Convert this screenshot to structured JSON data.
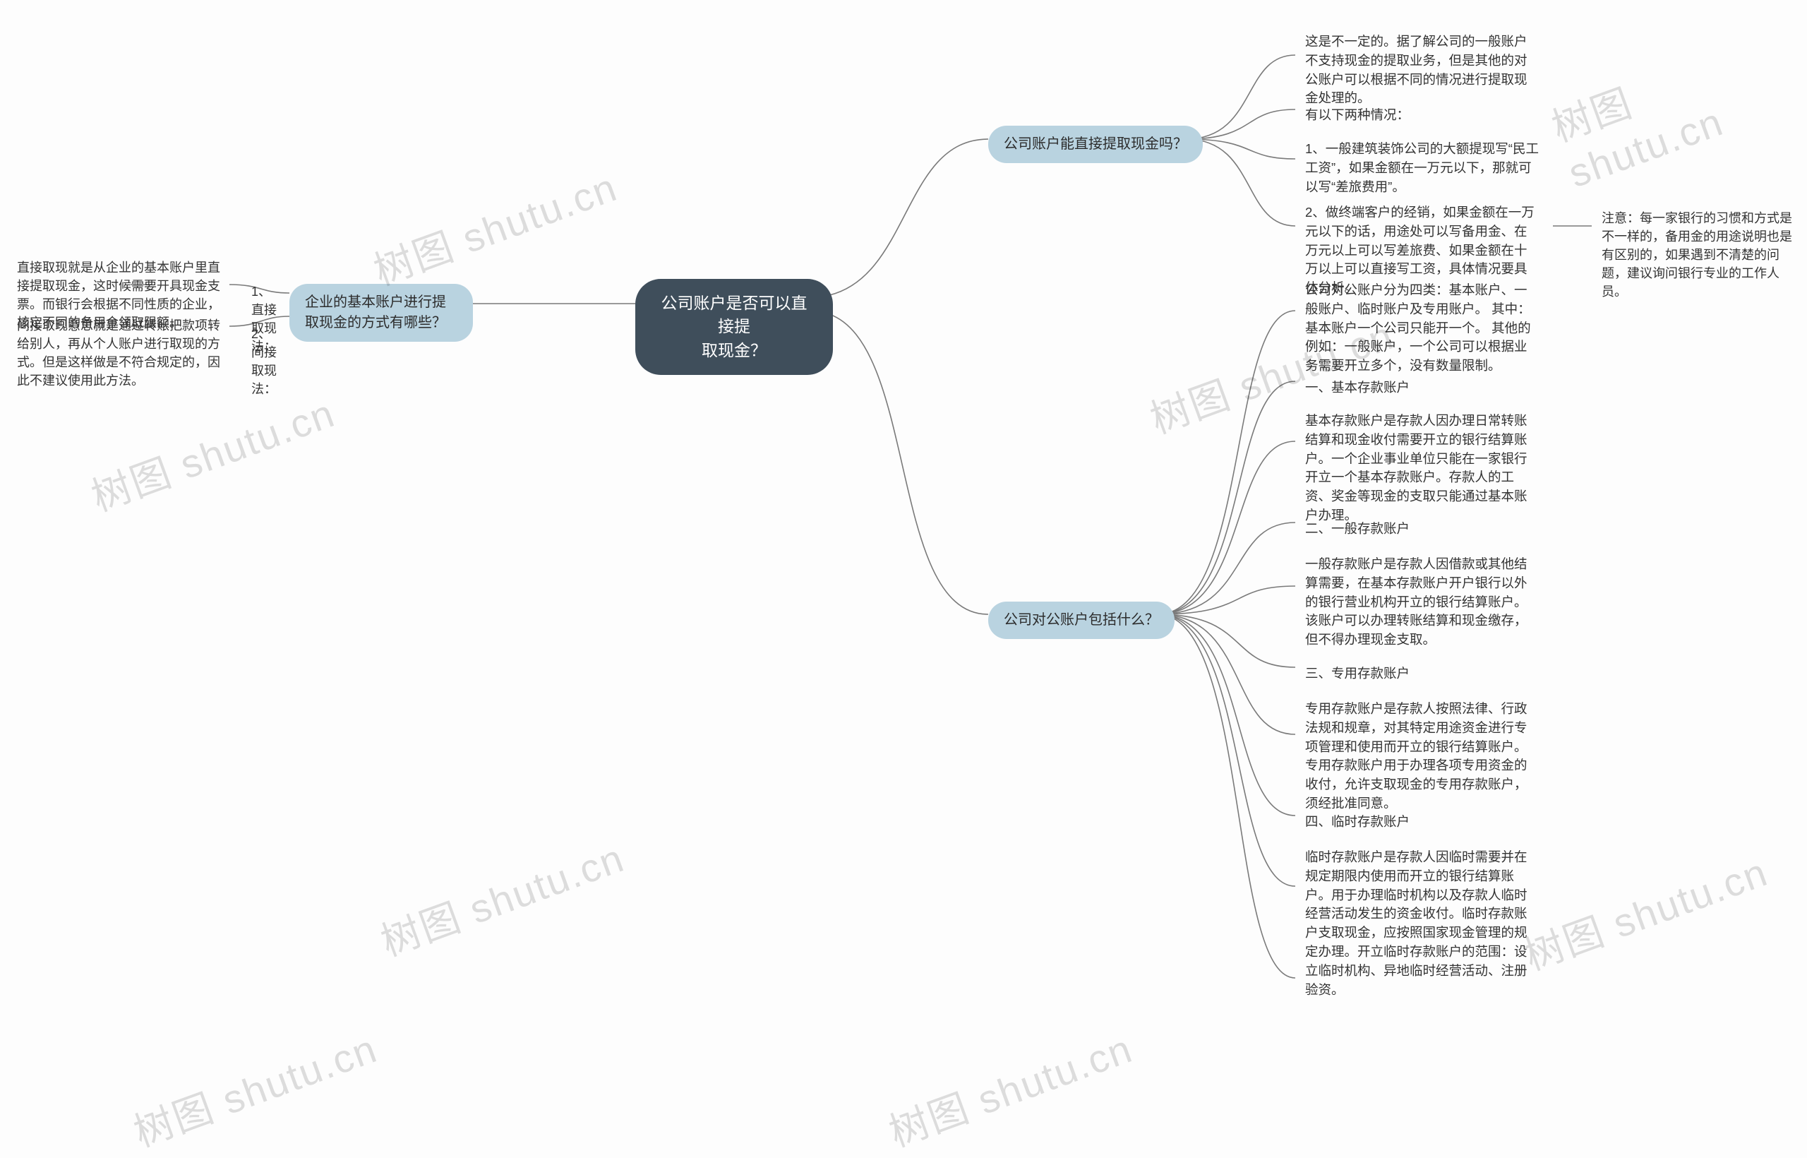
{
  "root": {
    "title_line1": "公司账户是否可以直接提",
    "title_line2": "取现金？"
  },
  "left": {
    "branch": "企业的基本账户进行提取现金的方式有哪些？",
    "item1": {
      "label": "1、直接取现法：",
      "desc": "直接取现就是从企业的基本账户里直接提取现金，这时候需要开具现金支票。而银行会根据不同性质的企业，核定不同的备用金领取限额。"
    },
    "item2": {
      "label": "2、间接取现法：",
      "desc": "间接取现意思就是通过转账把款项转给别人，再从个人账户进行取现的方式。但是这样做是不符合规定的，因此不建议使用此方法。"
    }
  },
  "right_top": {
    "branch": "公司账户能直接提取现金吗？",
    "n1": "这是不一定的。据了解公司的一般账户不支持现金的提取业务，但是其他的对公账户可以根据不同的情况进行提取现金处理的。",
    "n2": "有以下两种情况：",
    "n3": "1、一般建筑装饰公司的大额提现写“民工工资”，如果金额在一万元以下，那就可以写“差旅费用”。",
    "n4": "2、做终端客户的经销，如果金额在一万元以下的话，用途处可以写备用金、在万元以上可以写差旅费、如果金额在十万以上可以直接写工资，具体情况要具体分析。",
    "n4_note": "注意：每一家银行的习惯和方式是不一样的，备用金的用途说明也是有区别的，如果遇到不清楚的问题，建议询问银行专业的工作人员。"
  },
  "right_bottom": {
    "branch": "公司对公账户包括什么？",
    "p0": "公司对公账户分为四类：基本账户、一般账户、临时账户及专用账户。 其中： 基本账户一个公司只能开一个。 其他的例如：一般账户，一个公司可以根据业务需要开立多个，没有数量限制。",
    "h1": "一、基本存款账户",
    "p1": "基本存款账户是存款人因办理日常转账结算和现金收付需要开立的银行结算账户。一个企业事业单位只能在一家银行开立一个基本存款账户。存款人的工资、奖金等现金的支取只能通过基本账户办理。",
    "h2": "二、一般存款账户",
    "p2": "一般存款账户是存款人因借款或其他结算需要，在基本存款账户开户银行以外的银行营业机构开立的银行结算账户。该账户可以办理转账结算和现金缴存，但不得办理现金支取。",
    "h3": "三、专用存款账户",
    "p3": "专用存款账户是存款人按照法律、行政法规和规章，对其特定用途资金进行专项管理和使用而开立的银行结算账户。专用存款账户用于办理各项专用资金的收付，允许支取现金的专用存款账户，须经批准同意。",
    "h4": "四、临时存款账户",
    "p4": "临时存款账户是存款人因临时需要并在规定期限内使用而开立的银行结算账户。用于办理临时机构以及存款人临时经营活动发生的资金收付。临时存款账户支取现金，应按照国家现金管理的规定办理。开立临时存款账户的范围：设立临时机构、异地临时经营活动、注册验资。"
  },
  "watermark": "树图 shutu.cn"
}
